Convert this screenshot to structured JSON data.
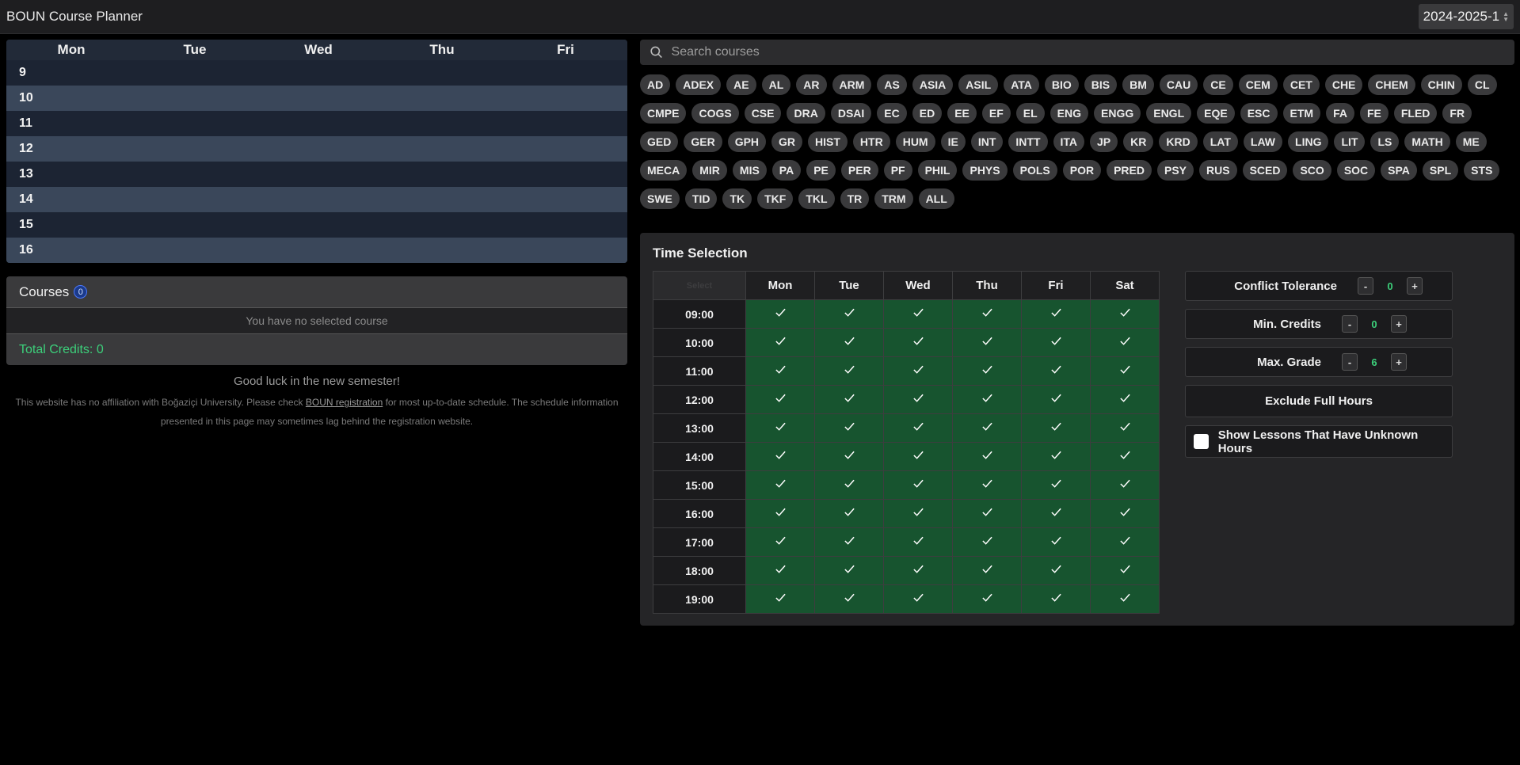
{
  "app": {
    "title": "BOUN Course Planner",
    "semester": "2024-2025-1"
  },
  "schedule": {
    "days": [
      "Mon",
      "Tue",
      "Wed",
      "Thu",
      "Fri"
    ],
    "hours": [
      "9",
      "10",
      "11",
      "12",
      "13",
      "14",
      "15",
      "16"
    ]
  },
  "courses": {
    "heading": "Courses",
    "count": "0",
    "empty_text": "You have no selected course",
    "total_credits": "Total Credits: 0"
  },
  "footer": {
    "goodluck": "Good luck in the new semester!",
    "disclaimer_pre": "This website has no affiliation with Boğaziçi University. Please check ",
    "disclaimer_link": "BOUN registration",
    "disclaimer_post": " for most up-to-date schedule. The schedule information presented in this page may sometimes lag behind the registration website."
  },
  "search": {
    "placeholder": "Search courses"
  },
  "departments": [
    "AD",
    "ADEX",
    "AE",
    "AL",
    "AR",
    "ARM",
    "AS",
    "ASIA",
    "ASIL",
    "ATA",
    "BIO",
    "BIS",
    "BM",
    "CAU",
    "CE",
    "CEM",
    "CET",
    "CHE",
    "CHEM",
    "CHIN",
    "CL",
    "CMPE",
    "COGS",
    "CSE",
    "DRA",
    "DSAI",
    "EC",
    "ED",
    "EE",
    "EF",
    "EL",
    "ENG",
    "ENGG",
    "ENGL",
    "EQE",
    "ESC",
    "ETM",
    "FA",
    "FE",
    "FLED",
    "FR",
    "GED",
    "GER",
    "GPH",
    "GR",
    "HIST",
    "HTR",
    "HUM",
    "IE",
    "INT",
    "INTT",
    "ITA",
    "JP",
    "KR",
    "KRD",
    "LAT",
    "LAW",
    "LING",
    "LIT",
    "LS",
    "MATH",
    "ME",
    "MECA",
    "MIR",
    "MIS",
    "PA",
    "PE",
    "PER",
    "PF",
    "PHIL",
    "PHYS",
    "POLS",
    "POR",
    "PRED",
    "PSY",
    "RUS",
    "SCED",
    "SCO",
    "SOC",
    "SPA",
    "SPL",
    "STS",
    "SWE",
    "TID",
    "TK",
    "TKF",
    "TKL",
    "TR",
    "TRM",
    "ALL"
  ],
  "time_selection": {
    "title": "Time Selection",
    "corner": "Select",
    "days": [
      "Mon",
      "Tue",
      "Wed",
      "Thu",
      "Fri",
      "Sat"
    ],
    "times": [
      "09:00",
      "10:00",
      "11:00",
      "12:00",
      "13:00",
      "14:00",
      "15:00",
      "16:00",
      "17:00",
      "18:00",
      "19:00"
    ],
    "all_selected": true,
    "selected_color": "#17542f"
  },
  "controls": {
    "conflict_tolerance": {
      "label": "Conflict Tolerance",
      "value": "0",
      "minus": "-",
      "plus": "+"
    },
    "min_credits": {
      "label": "Min. Credits",
      "value": "0",
      "minus": "-",
      "plus": "+"
    },
    "max_grade": {
      "label": "Max. Grade",
      "value": "6",
      "minus": "-",
      "plus": "+"
    },
    "exclude_full_hours": "Exclude Full Hours",
    "show_unknown_hours": "Show Lessons That Have Unknown Hours"
  }
}
